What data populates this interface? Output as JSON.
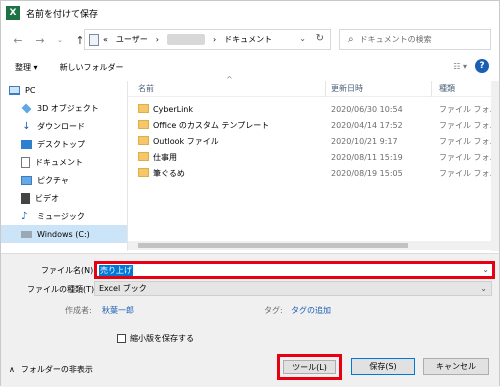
{
  "window": {
    "title": "名前を付けて保存"
  },
  "address": {
    "prefix": "«",
    "segment1": "ユーザー",
    "segment2": "ドキュメント"
  },
  "search": {
    "placeholder": "ドキュメントの検索"
  },
  "toolbar": {
    "organize": "整理 ▾",
    "new_folder": "新しいフォルダー"
  },
  "sidebar": {
    "items": [
      {
        "label": "PC",
        "icon": "pc-icon"
      },
      {
        "label": "3D オブジェクト",
        "icon": "3d-objects-icon"
      },
      {
        "label": "ダウンロード",
        "icon": "download-icon"
      },
      {
        "label": "デスクトップ",
        "icon": "desktop-icon"
      },
      {
        "label": "ドキュメント",
        "icon": "documents-icon"
      },
      {
        "label": "ピクチャ",
        "icon": "pictures-icon"
      },
      {
        "label": "ビデオ",
        "icon": "video-icon"
      },
      {
        "label": "ミュージック",
        "icon": "music-icon"
      },
      {
        "label": "Windows (C:)",
        "icon": "drive-icon"
      }
    ]
  },
  "columns": {
    "name": "名前",
    "date": "更新日時",
    "type": "種類"
  },
  "files": [
    {
      "name": "CyberLink",
      "date": "2020/06/30 10:54",
      "type": "ファイル フォル"
    },
    {
      "name": "Office のカスタム テンプレート",
      "date": "2020/04/14 17:52",
      "type": "ファイル フォル"
    },
    {
      "name": "Outlook ファイル",
      "date": "2020/10/21 9:17",
      "type": "ファイル フォル"
    },
    {
      "name": "仕事用",
      "date": "2020/08/11 15:19",
      "type": "ファイル フォル"
    },
    {
      "name": "筆ぐるめ",
      "date": "2020/08/19 15:05",
      "type": "ファイル フォル"
    }
  ],
  "form": {
    "filename_label": "ファイル名(N):",
    "filename_value": "売り上げ",
    "filetype_label": "ファイルの種類(T):",
    "filetype_value": "Excel ブック",
    "author_label": "作成者:",
    "author_value": "秋葉一郎",
    "tag_label": "タグ:",
    "tag_value": "タグの追加",
    "thumbnail_label": "縮小版を保存する"
  },
  "footer": {
    "hide_folders": "フォルダーの非表示",
    "tools": "ツール(L)",
    "save": "保存(S)",
    "cancel": "キャンセル"
  }
}
